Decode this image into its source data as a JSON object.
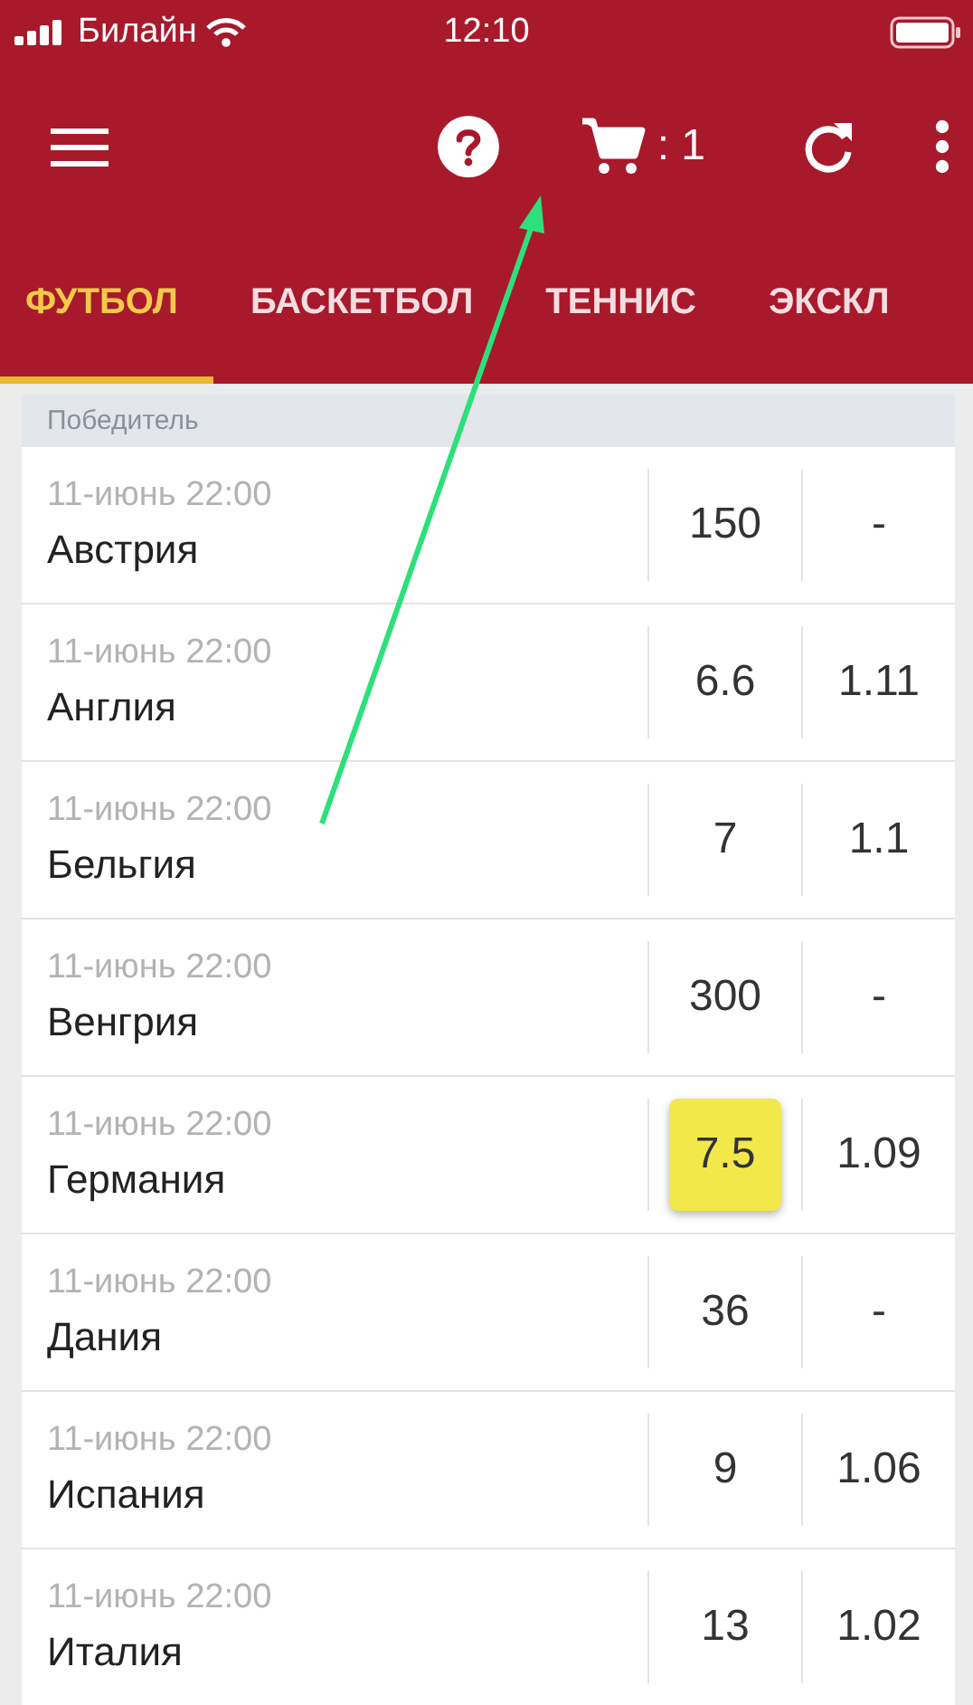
{
  "status_bar": {
    "carrier": "Билайн",
    "time": "12:10"
  },
  "app_bar": {
    "cart_count": ": 1"
  },
  "tabs": [
    {
      "label": "ФУТБОЛ",
      "selected": true
    },
    {
      "label": "БАСКЕТБОЛ",
      "selected": false
    },
    {
      "label": "ТЕННИС",
      "selected": false
    },
    {
      "label": "ЭКСКЛ",
      "selected": false
    }
  ],
  "market": {
    "title": "Победитель"
  },
  "rows": [
    {
      "date": "11-июнь 22:00",
      "team": "Австрия",
      "odds": [
        {
          "value": "150",
          "selected": false
        },
        {
          "value": "-",
          "selected": false
        }
      ]
    },
    {
      "date": "11-июнь 22:00",
      "team": "Англия",
      "odds": [
        {
          "value": "6.6",
          "selected": false
        },
        {
          "value": "1.11",
          "selected": false
        }
      ]
    },
    {
      "date": "11-июнь 22:00",
      "team": "Бельгия",
      "odds": [
        {
          "value": "7",
          "selected": false
        },
        {
          "value": "1.1",
          "selected": false
        }
      ]
    },
    {
      "date": "11-июнь 22:00",
      "team": "Венгрия",
      "odds": [
        {
          "value": "300",
          "selected": false
        },
        {
          "value": "-",
          "selected": false
        }
      ]
    },
    {
      "date": "11-июнь 22:00",
      "team": "Германия",
      "odds": [
        {
          "value": "7.5",
          "selected": true
        },
        {
          "value": "1.09",
          "selected": false
        }
      ]
    },
    {
      "date": "11-июнь 22:00",
      "team": "Дания",
      "odds": [
        {
          "value": "36",
          "selected": false
        },
        {
          "value": "-",
          "selected": false
        }
      ]
    },
    {
      "date": "11-июнь 22:00",
      "team": "Испания",
      "odds": [
        {
          "value": "9",
          "selected": false
        },
        {
          "value": "1.06",
          "selected": false
        }
      ]
    },
    {
      "date": "11-июнь 22:00",
      "team": "Италия",
      "odds": [
        {
          "value": "13",
          "selected": false
        },
        {
          "value": "1.02",
          "selected": false
        }
      ]
    }
  ]
}
